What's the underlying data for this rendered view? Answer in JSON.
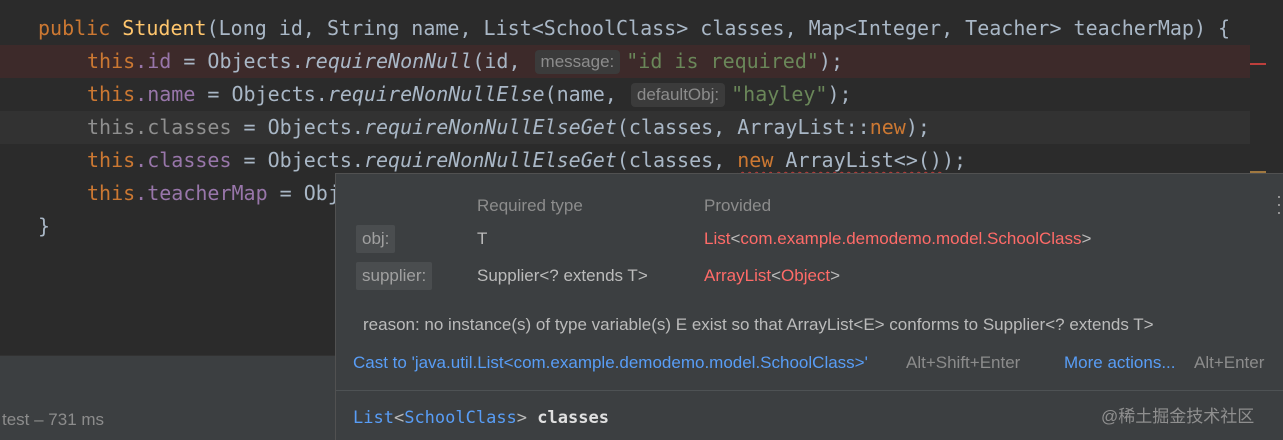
{
  "editor": {
    "lines": [
      {
        "a": "public ",
        "b": "Student",
        "c": "(Long id, String name, List<SchoolClass> classes, Map<Integer, Teacher> teacherMap) {"
      },
      {
        "this": "this",
        "field": ".id",
        "eq": " = Objects.",
        "method": "requireNonNull",
        "open": "(id, ",
        "hint": "message:",
        "str": "\"id is required\"",
        "close": ");"
      },
      {
        "this": "this",
        "field": ".name",
        "eq": " = Objects.",
        "method": "requireNonNullElse",
        "open": "(name, ",
        "hint": "defaultObj:",
        "str": "\"hayley\"",
        "close": ");"
      },
      {
        "this": "this",
        "field": ".classes",
        "eq": " = Objects.",
        "method": "requireNonNullElseGet",
        "open": "(classes, ArrayList::",
        "kw": "new",
        "close": ");"
      },
      {
        "this": "this",
        "field": ".classes",
        "eq": " = Objects.",
        "method": "requireNonNullElseGet",
        "open": "(classes, ",
        "squig_kw": "new",
        "squig_rest": " ArrayList<>()",
        "close": ");"
      },
      {
        "this": "this",
        "field": ".teacherMap",
        "eq": " = Obj"
      },
      {
        "brace": "}"
      }
    ]
  },
  "popup": {
    "col_required": "Required type",
    "col_provided": "Provided",
    "rows": [
      {
        "label": "obj:",
        "required": "T",
        "prov_a": "List",
        "prov_b": "<",
        "prov_c": "com.example.demodemo.model.SchoolClass",
        "prov_d": ">"
      },
      {
        "label": "supplier:",
        "required": "Supplier<? extends T>",
        "prov_a": "ArrayList",
        "prov_b": "<",
        "prov_c": "Object",
        "prov_d": ">"
      }
    ],
    "reason": "reason: no instance(s) of type variable(s) E exist so that ArrayList<E> conforms to Supplier<? extends T>",
    "cast_action": "Cast to 'java.util.List<com.example.demodemo.model.SchoolClass>'",
    "cast_shortcut": "Alt+Shift+Enter",
    "more_action": "More actions...",
    "more_shortcut": "Alt+Enter",
    "decl_type_a": "List",
    "decl_type_b": "<",
    "decl_type_c": "SchoolClass",
    "decl_type_d": ">",
    "decl_name": "classes",
    "watermark": "@稀土掘金技术社区",
    "more_icon": "vertical-dots-icon"
  },
  "status": {
    "text": "test – 731 ms"
  },
  "colors": {
    "error": "#ff6b68",
    "link": "#589df6",
    "keyword": "#cc7832",
    "field": "#9876aa",
    "string": "#6a8759",
    "function": "#ffc66d"
  }
}
